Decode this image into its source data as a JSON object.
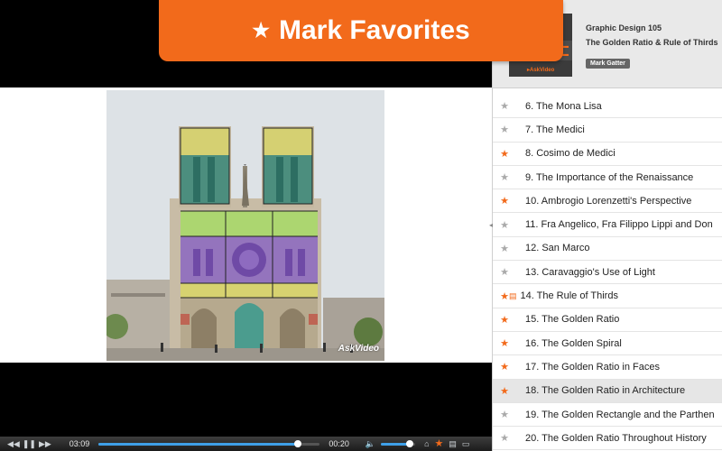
{
  "banner": {
    "label": "Mark Favorites",
    "icon": "star-icon"
  },
  "video": {
    "watermark": "AskVideo"
  },
  "controls": {
    "elapsed": "03:09",
    "remaining": "00:20",
    "progress": 0.9,
    "volume": 0.85
  },
  "course": {
    "subtitle": "Graphic Design 105",
    "title": "The Golden Ratio & Rule of Thirds",
    "author": "Mark Gatter"
  },
  "lessons": [
    {
      "title": "6. The Mona Lisa",
      "favorite": false,
      "note": false,
      "active": false
    },
    {
      "title": "7. The Medici",
      "favorite": false,
      "note": false,
      "active": false
    },
    {
      "title": "8. Cosimo de Medici",
      "favorite": true,
      "note": false,
      "active": false
    },
    {
      "title": "9. The Importance of the Renaissance",
      "favorite": false,
      "note": false,
      "active": false
    },
    {
      "title": "10. Ambrogio Lorenzetti's Perspective",
      "favorite": true,
      "note": false,
      "active": false
    },
    {
      "title": "11. Fra Angelico, Fra Filippo Lippi and Don",
      "favorite": false,
      "note": false,
      "active": false
    },
    {
      "title": "12. San Marco",
      "favorite": false,
      "note": false,
      "active": false
    },
    {
      "title": "13. Caravaggio's Use of Light",
      "favorite": false,
      "note": false,
      "active": false
    },
    {
      "title": "14. The Rule of Thirds",
      "favorite": true,
      "note": true,
      "active": false
    },
    {
      "title": "15. The Golden Ratio",
      "favorite": true,
      "note": false,
      "active": false
    },
    {
      "title": "16. The Golden Spiral",
      "favorite": true,
      "note": false,
      "active": false
    },
    {
      "title": "17. The Golden Ratio in Faces",
      "favorite": true,
      "note": false,
      "active": false
    },
    {
      "title": "18. The Golden Ratio in Architecture",
      "favorite": true,
      "note": false,
      "active": true
    },
    {
      "title": "19. The Golden Rectangle and the Parthen",
      "favorite": false,
      "note": false,
      "active": false
    },
    {
      "title": "20. The Golden Ratio Throughout History",
      "favorite": false,
      "note": false,
      "active": false
    }
  ],
  "colors": {
    "accent": "#f26a1b",
    "progress": "#3fa0e8"
  }
}
